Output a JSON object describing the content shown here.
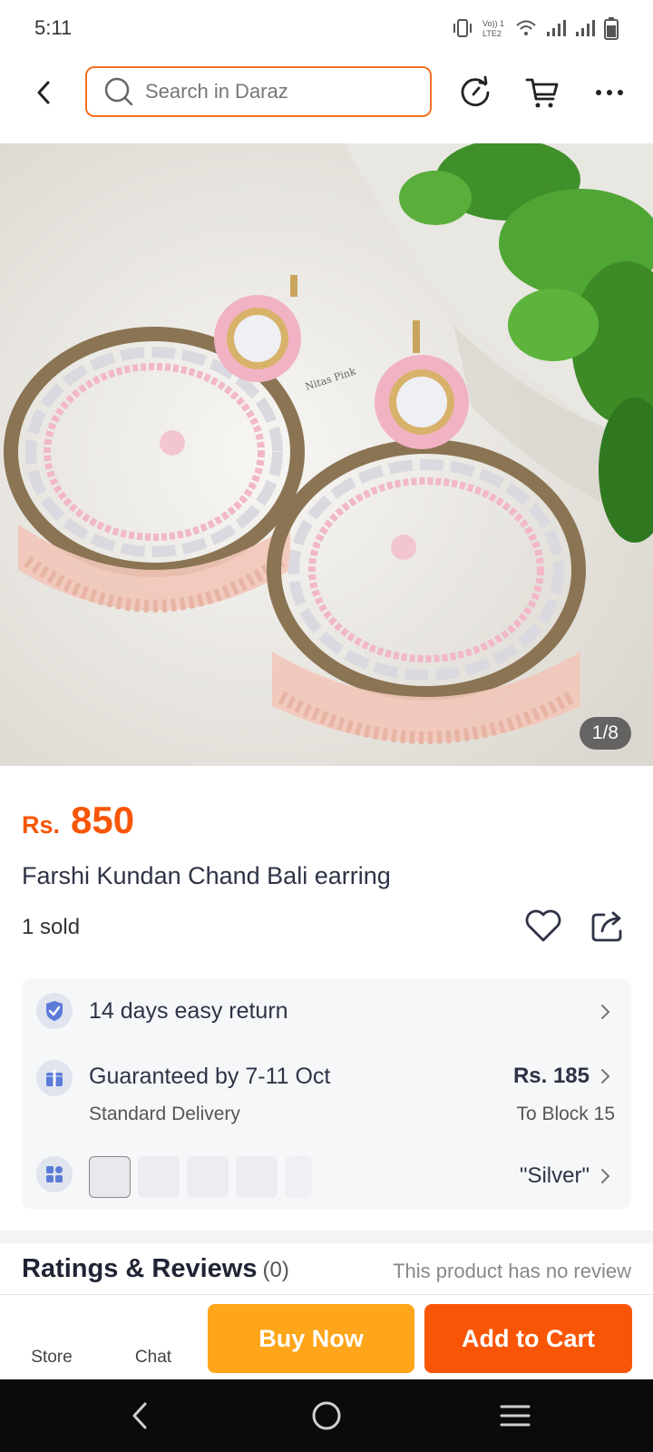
{
  "status_bar": {
    "time": "5:11",
    "icons": [
      "vibrate-icon",
      "volte-icon",
      "wifi-icon",
      "signal-icon",
      "signal-icon",
      "battery-icon"
    ],
    "volte_label_top": "Vo)) 1",
    "volte_label_bottom": "LTE2"
  },
  "header": {
    "search_placeholder": "Search in Daraz",
    "icons": [
      "back-arrow-icon",
      "search-icon",
      "history-icon",
      "cart-icon",
      "more-icon"
    ]
  },
  "gallery": {
    "counter": "1/8",
    "watermark": "Nitas Pink"
  },
  "product": {
    "currency": "Rs.",
    "price": "850",
    "title": "Farshi Kundan Chand Bali earring",
    "sold": "1 sold"
  },
  "services": {
    "return": {
      "label": "14 days easy return"
    },
    "delivery": {
      "label": "Guaranteed by 7-11 Oct",
      "sub": "Standard Delivery",
      "fee": "Rs. 185",
      "destination": "To Block 15"
    },
    "variant": {
      "selected": "\"Silver\"",
      "chip_labels": [
        "...",
        "...",
        "...",
        "...",
        "..."
      ]
    }
  },
  "reviews": {
    "title": "Ratings & Reviews",
    "count": "(0)",
    "note": "This product has no review"
  },
  "actions": {
    "store": "Store",
    "chat": "Chat",
    "buy_now": "Buy Now",
    "add_to_cart": "Add to Cart"
  },
  "colors": {
    "brand_orange": "#f85606",
    "buy_now_yellow": "#fea51a",
    "search_border": "#f36f1f"
  }
}
